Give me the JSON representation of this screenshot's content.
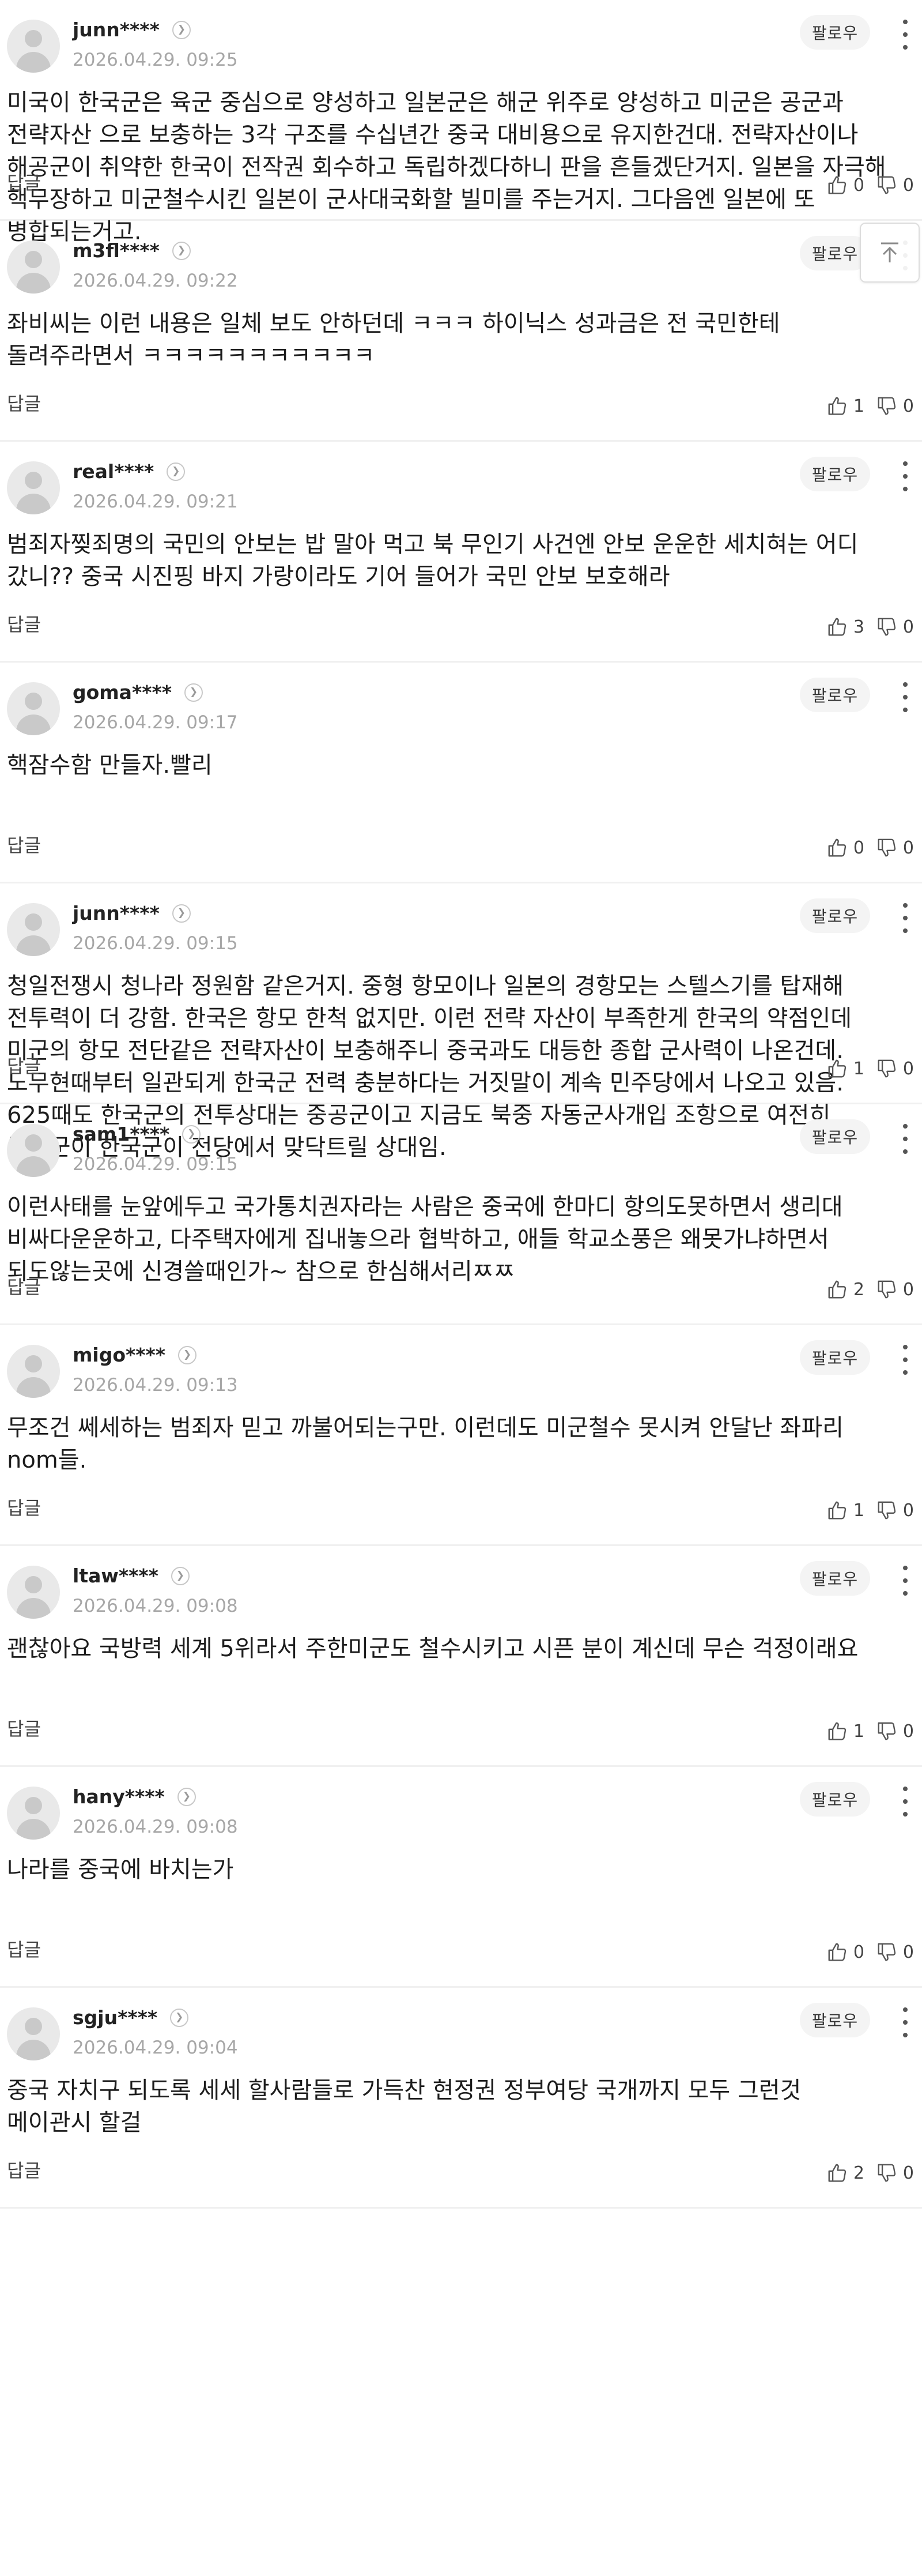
{
  "ui": {
    "follow_label": "팔로우",
    "reply_label": "답글"
  },
  "comments": [
    {
      "user": "junn****",
      "date": "2026.04.29. 09:25",
      "text": "미국이 한국군은 육군 중심으로 양성하고 일본군은 해군 위주로 양성하고 미군은 공군과 전략자산 으로 보충하는 3각 구조를 수십년간 중국 대비용으로 유지한건대. 전략자산이나 해공군이 취약한 한국이 전작권 회수하고 독립하겠다하니 판을 흔들겠단거지. 일본을 자극해 핵무장하고 미군철수시킨 일본이 군사대국화할 빌미를 주는거지. 그다음엔 일본에 또 병합되는거고.",
      "likes": "0",
      "dislikes": "0"
    },
    {
      "user": "m3fl****",
      "date": "2026.04.29. 09:22",
      "text": "좌비씨는 이런 내용은 일체 보도 안하던데 ㅋㅋㅋ 하이닉스 성과금은 전 국민한테 돌려주라면서 ㅋㅋㅋㅋㅋㅋㅋㅋㅋㅋㅋ",
      "likes": "1",
      "dislikes": "0"
    },
    {
      "user": "real****",
      "date": "2026.04.29. 09:21",
      "text": "범죄자찢죄명의 국민의 안보는 밥 말아 먹고 북 무인기 사건엔 안보 운운한 세치혀는 어디 갔니?? 중국 시진핑 바지 가랑이라도 기어 들어가 국민 안보 보호해라",
      "likes": "3",
      "dislikes": "0"
    },
    {
      "user": "goma****",
      "date": "2026.04.29. 09:17",
      "text": "핵잠수함 만들자.빨리",
      "likes": "0",
      "dislikes": "0"
    },
    {
      "user": "junn****",
      "date": "2026.04.29. 09:15",
      "text": "청일전쟁시 청나라 정원함 같은거지. 중형 항모이나 일본의 경항모는 스텔스기를 탑재해 전투력이 더 강함. 한국은 항모 한척 없지만. 이런 전략 자산이 부족한게 한국의 약점인데 미군의 항모 전단같은 전략자산이 보충해주니 중국과도 대등한 종합 군사력이 나온건데. 노무현때부터 일관되게 한국군 전력 충분하다는 거짓말이 계속 민주당에서 나오고 있음. 625때도 한국군의 전투상대는 중공군이고 지금도 북중 자동군사개입 조항으로 여전히 중공군이 한국군이 전당에서 맞닥트릴 상대임.",
      "likes": "1",
      "dislikes": "0"
    },
    {
      "user": "sam1****",
      "date": "2026.04.29. 09:15",
      "text": "이런사태를 눈앞에두고 국가통치권자라는 사람은 중국에 한마디 항의도못하면서 생리대 비싸다운운하고, 다주택자에게 집내놓으라 협박하고, 애들 학교소풍은 왜못가냐하면서 되도않는곳에 신경쓸때인가~ 참으로 한심해서리ㅉㅉ",
      "likes": "2",
      "dislikes": "0"
    },
    {
      "user": "migo****",
      "date": "2026.04.29. 09:13",
      "text": "무조건 쎄세하는 범죄자 믿고 까불어되는구만. 이런데도 미군철수 못시켜 안달난 좌파리 nom들.",
      "likes": "1",
      "dislikes": "0"
    },
    {
      "user": "ltaw****",
      "date": "2026.04.29. 09:08",
      "text": "괜찮아요 국방력 세계 5위라서 주한미군도 철수시키고 시픈 분이 계신데 무슨 걱정이래요",
      "likes": "1",
      "dislikes": "0"
    },
    {
      "user": "hany****",
      "date": "2026.04.29. 09:08",
      "text": "나라를 중국에 바치는가",
      "likes": "0",
      "dislikes": "0"
    },
    {
      "user": "sgju****",
      "date": "2026.04.29. 09:04",
      "text": "중국 자치구 되도록 세세 할사람들로 가득찬 현정권 정부여당 국개까지 모두 그런것 메이관시 할걸",
      "likes": "2",
      "dislikes": "0"
    }
  ]
}
